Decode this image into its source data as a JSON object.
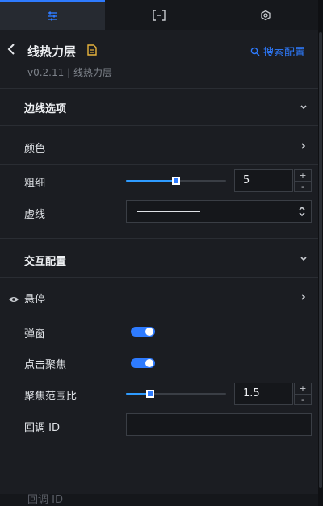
{
  "tabs": [
    {
      "name": "style",
      "icon": "sliders-icon",
      "active": true
    },
    {
      "name": "data",
      "icon": "bracket-icon",
      "active": false
    },
    {
      "name": "interaction",
      "icon": "refresh-icon",
      "active": false
    }
  ],
  "header": {
    "title": "线热力层",
    "version": "v0.2.11 | 线热力层",
    "search_label": "搜索配置",
    "back_icon": "chevron-left-icon",
    "doc_icon": "document-icon",
    "search_icon": "search-icon"
  },
  "sections": {
    "border": {
      "title": "边线选项",
      "color_label": "颜色",
      "width_label": "粗细",
      "width_value": "5",
      "width_slider_fraction": 0.5,
      "dash_label": "虚线"
    },
    "interaction": {
      "title": "交互配置",
      "hover_label": "悬停",
      "popup_label": "弹窗",
      "popup_enabled": true,
      "focus_label": "点击聚焦",
      "focus_enabled": true,
      "focus_range_label": "聚焦范围比",
      "focus_range_value": "1.5",
      "focus_range_fraction": 0.24,
      "callback_label": "回调 ID",
      "callback_value": ""
    }
  },
  "footer_ghost_text": "回调 ID",
  "colors": {
    "accent": "#2e7bff",
    "bg": "#1b1d22"
  }
}
